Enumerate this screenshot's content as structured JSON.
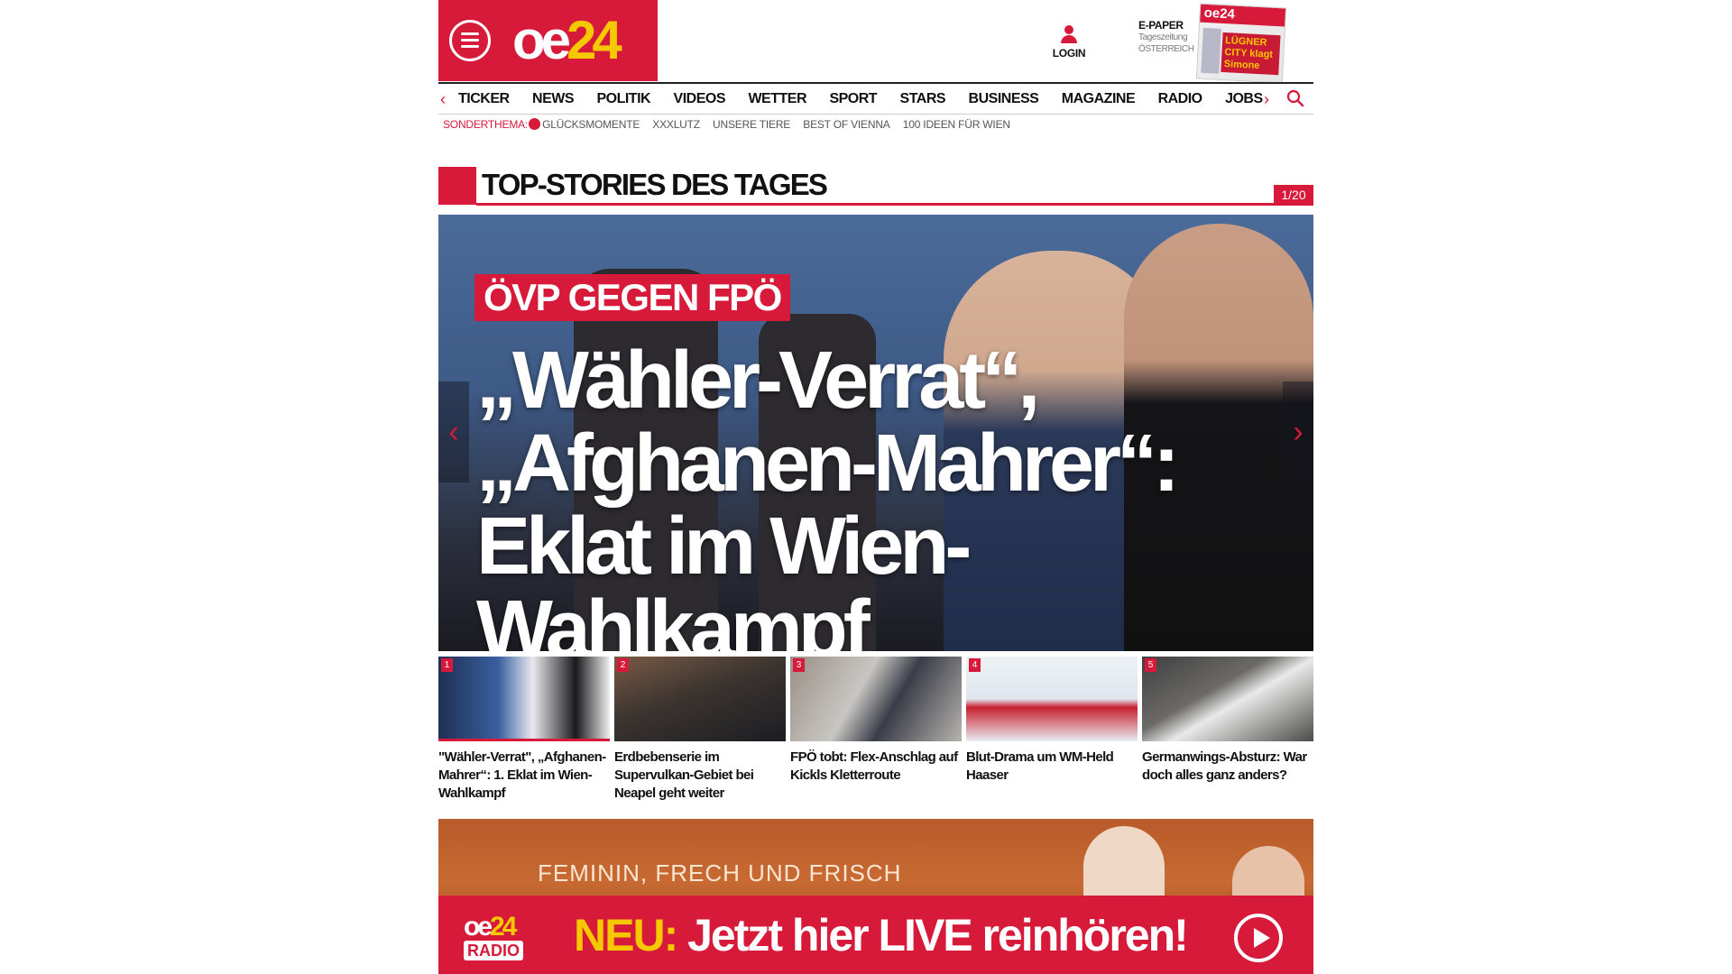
{
  "brand": {
    "logo_oe": "oe",
    "logo_num": "24"
  },
  "header": {
    "login_label": "LOGIN",
    "epaper_title": "E-PAPER",
    "epaper_sub1": "Tageszeitung",
    "epaper_sub2": "ÖSTERREICH",
    "epaper_thumb_brand": "oe24",
    "epaper_thumb_headline": "LÜGNER CITY klagt Simone"
  },
  "nav": {
    "prev": "‹",
    "next": "›",
    "items": [
      "TICKER",
      "NEWS",
      "POLITIK",
      "VIDEOS",
      "WETTER",
      "SPORT",
      "STARS",
      "BUSINESS",
      "MAGAZINE",
      "RADIO",
      "JOBS"
    ]
  },
  "subnav": {
    "label": "SONDERTHEMA:",
    "items": [
      "GLÜCKSMOMENTE",
      "XXXLUTZ",
      "UNSERE TIERE",
      "BEST OF VIENNA",
      "100 IDEEN FÜR WIEN"
    ]
  },
  "section": {
    "title": "TOP-STORIES DES TAGES",
    "counter": "1/20"
  },
  "hero": {
    "kicker": "ÖVP GEGEN FPÖ",
    "headline_line1": "„Wähler-Verrat“,",
    "headline_line2": "„Afghanen-Mahrer“:",
    "headline_line3": "Eklat im Wien-Wahlkampf",
    "prev": "‹",
    "next": "›"
  },
  "teasers": [
    {
      "num": "1",
      "title": "\"Wähler-Verrat\", „Afghanen-Mahrer“: 1. Eklat im Wien-Wahlkampf"
    },
    {
      "num": "2",
      "title": "Erdbebenserie im Supervulkan-Gebiet bei Neapel geht weiter"
    },
    {
      "num": "3",
      "title": "FPÖ tobt: Flex-Anschlag auf Kickls Kletterroute"
    },
    {
      "num": "4",
      "title": "Blut-Drama um WM-Held Haaser"
    },
    {
      "num": "5",
      "title": "Germanwings-Absturz: War doch alles ganz anders?"
    }
  ],
  "banner": {
    "tagline": "FEMININ, FRECH UND FRISCH",
    "radio_logo_oe": "oe",
    "radio_logo_num": "24",
    "radio_logo_label": "RADIO",
    "cta_neu": "NEU:",
    "cta_text": " Jetzt hier LIVE reinhören!"
  },
  "colors": {
    "brand_red": "#d7193a",
    "brand_yellow": "#f6c800"
  }
}
